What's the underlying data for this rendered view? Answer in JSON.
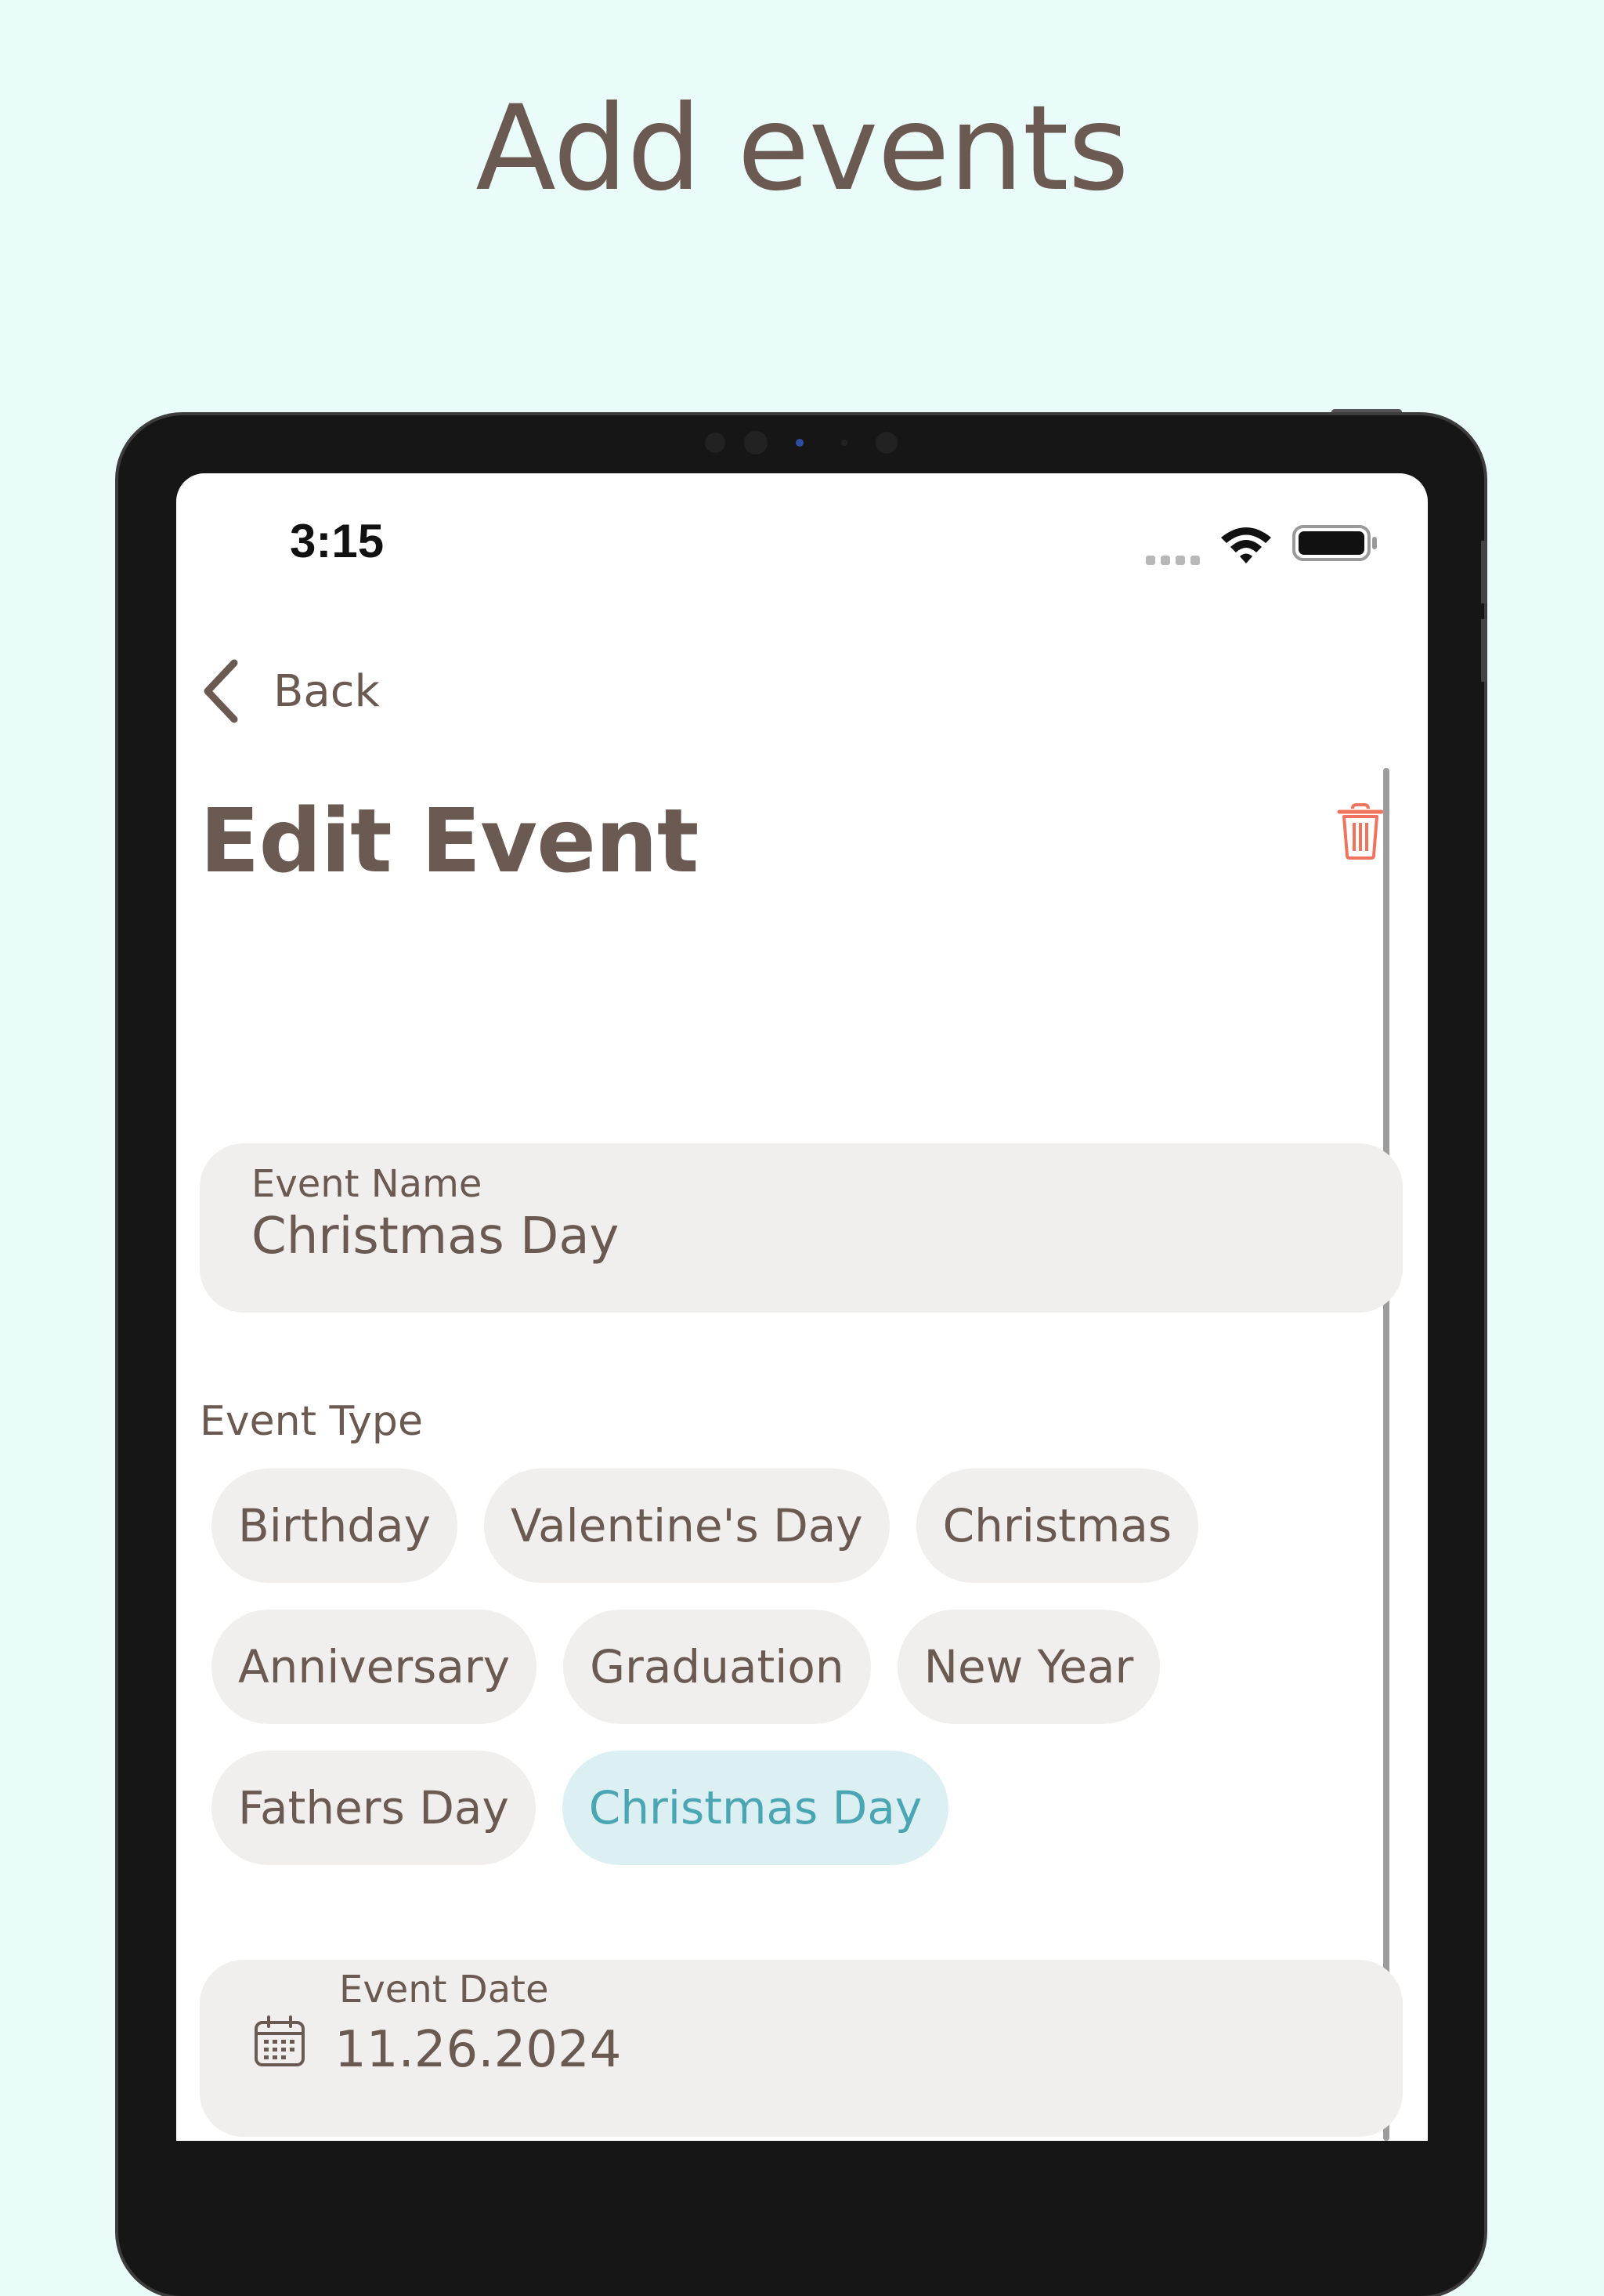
{
  "headline": "Add events",
  "status_bar": {
    "time": "3:15"
  },
  "nav": {
    "back_label": "Back"
  },
  "page": {
    "title": "Edit Event"
  },
  "event_name": {
    "label": "Event Name",
    "value": "Christmas Day"
  },
  "event_type": {
    "label": "Event Type",
    "options": [
      "Birthday",
      "Valentine's Day",
      "Christmas",
      "Anniversary",
      "Graduation",
      "New Year",
      "Fathers Day",
      "Christmas Day"
    ],
    "selected": "Christmas Day"
  },
  "event_date": {
    "label": "Event Date",
    "value": "11.26.2024"
  },
  "colors": {
    "background": "#eafcf9",
    "text": "#6b5a52",
    "field_bg": "#f0efee",
    "selected_chip_bg": "#dceff2",
    "selected_chip_text": "#4aa6b2",
    "trash": "#f0735f"
  },
  "icons": {
    "back": "chevron-left-icon",
    "delete": "trash-icon",
    "date": "calendar-icon",
    "wifi": "wifi-icon",
    "battery": "battery-icon"
  }
}
